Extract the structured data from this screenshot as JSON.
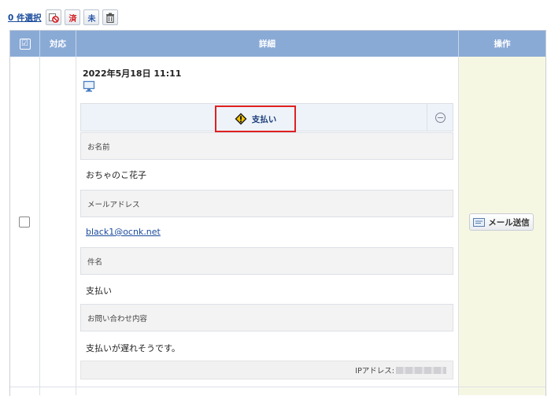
{
  "toolbar": {
    "selection_label": "0 件選択",
    "buttons": [
      {
        "name": "cancel-selection",
        "icon": "no-entry-icon"
      },
      {
        "name": "mark-done",
        "glyph": "済"
      },
      {
        "name": "mark-undone",
        "glyph": "未"
      },
      {
        "name": "delete",
        "icon": "trash-icon"
      }
    ]
  },
  "table": {
    "headers": {
      "check": "☑",
      "status": "対応",
      "detail": "詳細",
      "actions": "操作"
    }
  },
  "entry": {
    "datetime": "2022年5月18日 11:11",
    "device_icon": "desktop-icon",
    "status_label": "支払い",
    "status_icon": "warning-diamond-icon",
    "fields": [
      {
        "label": "お名前",
        "value": "おちゃのこ花子"
      },
      {
        "label": "メールアドレス",
        "value": "black1@ocnk.net"
      },
      {
        "label": "件名",
        "value": "支払い"
      },
      {
        "label": "お問い合わせ内容",
        "value": "支払いが遅れそうです。"
      }
    ],
    "ip_label": "IPアドレス:",
    "mail_button_label": "メール送信"
  },
  "colors": {
    "header_bg": "#8aaad6",
    "action_col_bg": "#f6f7e3",
    "highlight_border": "#e02020",
    "link": "#1a4b9c"
  }
}
